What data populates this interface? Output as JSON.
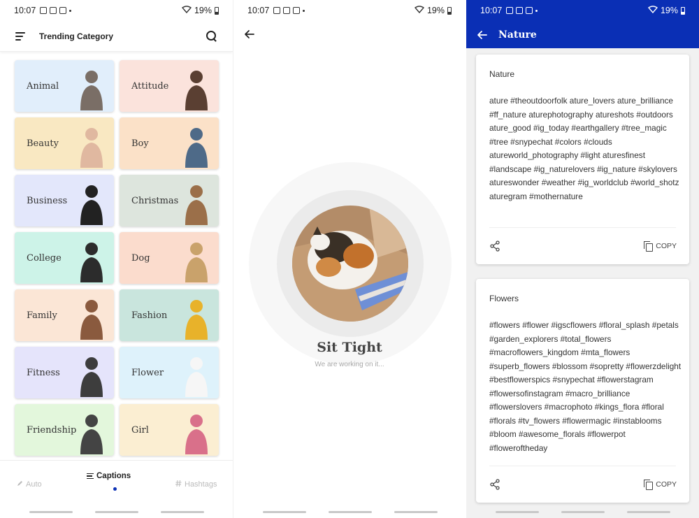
{
  "status": {
    "time": "10:07",
    "battery": "19%"
  },
  "category_screen": {
    "title": "Trending Category",
    "categories": [
      {
        "label": "Animal",
        "bg": "#e1eefb"
      },
      {
        "label": "Attitude",
        "bg": "#fbe3dc"
      },
      {
        "label": "Beauty",
        "bg": "#f9e8c2"
      },
      {
        "label": "Boy",
        "bg": "#fbe1c8"
      },
      {
        "label": "Business",
        "bg": "#e3e7fb"
      },
      {
        "label": "Christmas",
        "bg": "#dde5dd"
      },
      {
        "label": "College",
        "bg": "#cdf3e8"
      },
      {
        "label": "Dog",
        "bg": "#fbdccd"
      },
      {
        "label": "Family",
        "bg": "#fbe6d6"
      },
      {
        "label": "Fashion",
        "bg": "#c9e5dd"
      },
      {
        "label": "Fitness",
        "bg": "#e5e4fb"
      },
      {
        "label": "Flower",
        "bg": "#def2fb"
      },
      {
        "label": "Friendship",
        "bg": "#e3f7dc"
      },
      {
        "label": "Girl",
        "bg": "#fbeed2"
      }
    ],
    "nav": {
      "auto": "Auto",
      "captions": "Captions",
      "hashtags": "Hashtags"
    }
  },
  "loading_screen": {
    "title": "Sit Tight",
    "subtitle": "We are working on it..."
  },
  "hashtag_screen": {
    "title": "Nature",
    "copy_label": "COPY",
    "cards": [
      {
        "title": "Nature",
        "text": "ature #theoutdoorfolk ature_lovers ature_brilliance #ff_nature aturephotography atureshots #outdoors ature_good #ig_today #earthgallery #tree_magic #tree #snypechat #colors #clouds atureworld_photography #light aturesfinest #landscape #ig_naturelovers #ig_nature #skylovers atureswonder #weather #ig_worldclub #world_shotz aturegram #mothernature"
      },
      {
        "title": "Flowers",
        "text": "#flowers #flower #igscflowers #floral_splash #petals #garden_explorers #total_flowers #macroflowers_kingdom #mta_flowers #superb_flowers #blossom #sopretty #flowerzdelight #bestflowerspics #snypechat #flowerstagram #flowersofinstagram #macro_brilliance #flowerslovers #macrophoto #kings_flora #floral #florals #tv_flowers #flowermagic #instablooms #bloom #awesome_florals #flowerpot #floweroftheday"
      }
    ]
  }
}
